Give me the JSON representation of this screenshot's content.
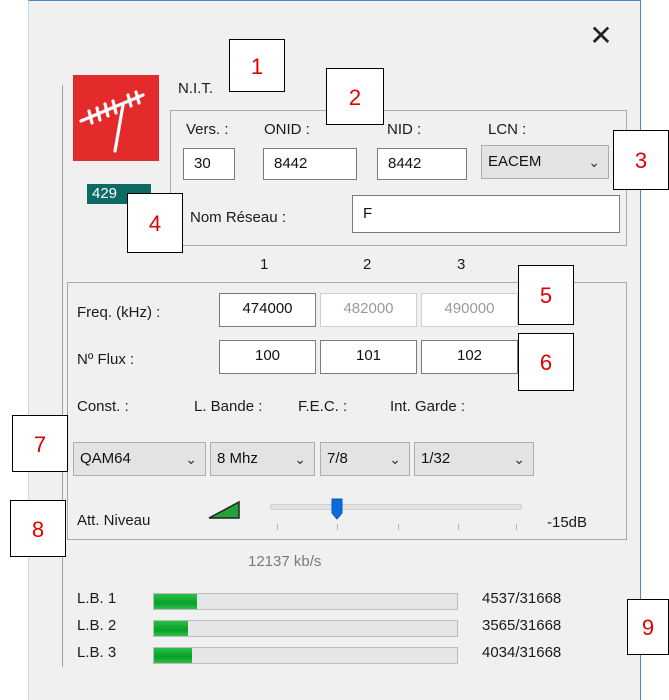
{
  "window": {
    "close_glyph": "✕"
  },
  "logo": {
    "icon": "antenna-icon",
    "color": "#e32b2b"
  },
  "badge": {
    "text": "429"
  },
  "nit": {
    "title": "N.I.T.",
    "vers_label": "Vers. :",
    "vers_value": "30",
    "onid_label": "ONID :",
    "onid_value": "8442",
    "nid_label": "NID :",
    "nid_value": "8442",
    "lcn_label": "LCN :",
    "lcn_value": "EACEM",
    "network_name_label": "Nom Réseau :",
    "network_name_value": "F"
  },
  "columns": {
    "c1": "1",
    "c2": "2",
    "c3": "3"
  },
  "multiplex": {
    "freq_label": "Freq. (kHz) :",
    "freq": [
      "474000",
      "482000",
      "490000"
    ],
    "flux_label": "Nº Flux :",
    "flux": [
      "100",
      "101",
      "102"
    ],
    "const_label": "Const. :",
    "bandwidth_label": "L. Bande :",
    "fec_label": "F.E.C. :",
    "guard_label": "Int. Garde :",
    "const_value": "QAM64",
    "bandwidth_value": "8 Mhz",
    "fec_value": "7/8",
    "guard_value": "1/32",
    "level_label": "Att. Niveau",
    "level_value": "-15dB",
    "level_fraction": 0.25,
    "bitrate": "12137 kb/s"
  },
  "bitrate_bars": [
    {
      "label": "L.B. 1",
      "value": "4537/31668",
      "fraction": 0.143
    },
    {
      "label": "L.B. 2",
      "value": "3565/31668",
      "fraction": 0.113
    },
    {
      "label": "L.B. 3",
      "value": "4034/31668",
      "fraction": 0.127
    }
  ],
  "callouts": [
    "1",
    "2",
    "3",
    "4",
    "5",
    "6",
    "7",
    "8",
    "9"
  ],
  "colors": {
    "accent_red": "#e00000",
    "teal": "#0d6b63",
    "bar_green": "#06a02a",
    "slider_blue": "#0a6cd8"
  }
}
